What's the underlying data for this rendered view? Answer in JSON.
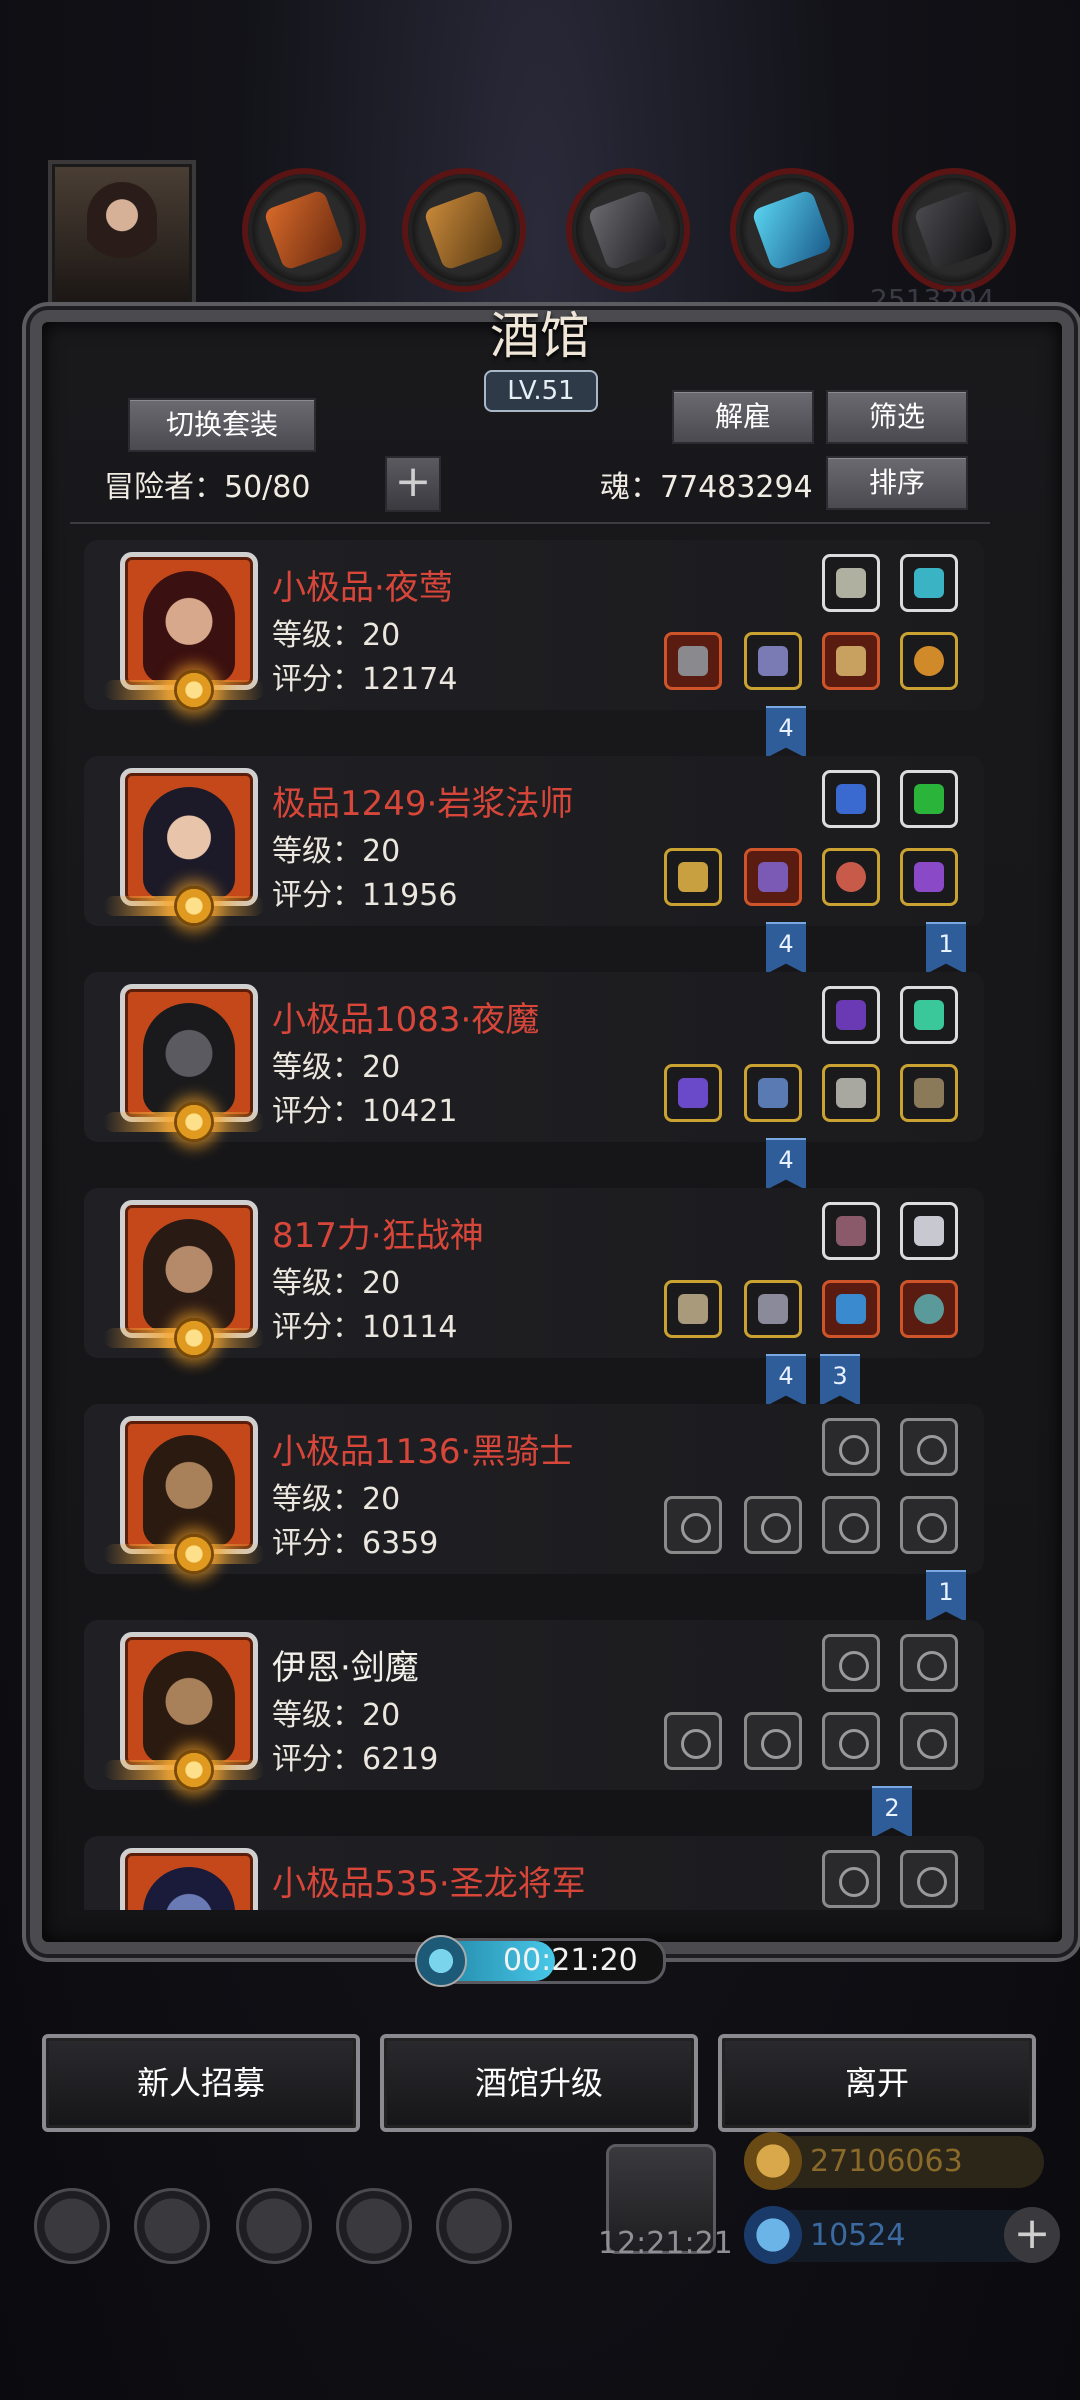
{
  "top": {
    "bg_number": "2513294"
  },
  "panel": {
    "title": "酒馆",
    "level": "LV.51",
    "switch_set_label": "切换套装",
    "dismiss_label": "解雇",
    "filter_label": "筛选",
    "sort_label": "排序",
    "adventurers_label": "冒险者：50/80",
    "plus_label": "+",
    "soul_label": "魂：77483294"
  },
  "heroes": [
    {
      "name": "小极品·夜莺",
      "name_color": "red",
      "level": "等级：20",
      "score": "评分：12174",
      "tags": [
        "4"
      ]
    },
    {
      "name": "极品1249·岩浆法师",
      "name_color": "red",
      "level": "等级：20",
      "score": "评分：11956",
      "tags": [
        "4",
        "1"
      ]
    },
    {
      "name": "小极品1083·夜魔",
      "name_color": "red",
      "level": "等级：20",
      "score": "评分：10421",
      "tags": [
        "4"
      ]
    },
    {
      "name": "817力·狂战神",
      "name_color": "red",
      "level": "等级：20",
      "score": "评分：10114",
      "tags": [
        "4",
        "3"
      ]
    },
    {
      "name": "小极品1136·黑骑士",
      "name_color": "red",
      "level": "等级：20",
      "score": "评分：6359",
      "tags": [
        "1"
      ]
    },
    {
      "name": "伊恩·剑魔",
      "name_color": "white",
      "level": "等级：20",
      "score": "评分：6219",
      "tags": [
        "2"
      ]
    },
    {
      "name": "小极品535·圣龙将军",
      "name_color": "red",
      "level": "",
      "score": "",
      "tags": []
    }
  ],
  "timer": {
    "text": "00:21:20",
    "progress": 0.55
  },
  "bottom_buttons": {
    "recruit": "新人招募",
    "upgrade": "酒馆升级",
    "leave": "离开"
  },
  "hud": {
    "time": "12:21:21",
    "gold": "27106063",
    "gems": "10524",
    "add": "+"
  },
  "colors": {
    "name_red": "#d8463a",
    "tag_blue": "#2f5d9a",
    "gold_text": "#8a6a2a",
    "gem_text": "#3a6aa0"
  },
  "icons": [
    "search-icon"
  ]
}
